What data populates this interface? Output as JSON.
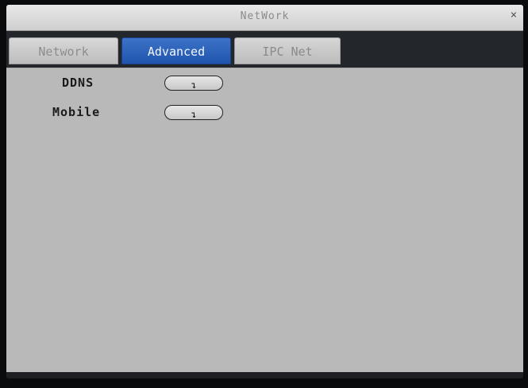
{
  "window": {
    "title": "NetWork",
    "close_glyph": "×"
  },
  "tabs": [
    {
      "label": "Network",
      "active": false
    },
    {
      "label": "Advanced",
      "active": true
    },
    {
      "label": "IPC Net",
      "active": false
    }
  ],
  "settings": [
    {
      "label": "DDNS",
      "button_icon": "enter-arrow-icon",
      "button_glyph": "↴"
    },
    {
      "label": "Mobile",
      "button_icon": "enter-arrow-icon",
      "button_glyph": "↴"
    }
  ],
  "colors": {
    "active_tab": "#2a5fb8",
    "content_bg": "#b9b9b9",
    "titlebar_bg": "#dcdcdc"
  }
}
